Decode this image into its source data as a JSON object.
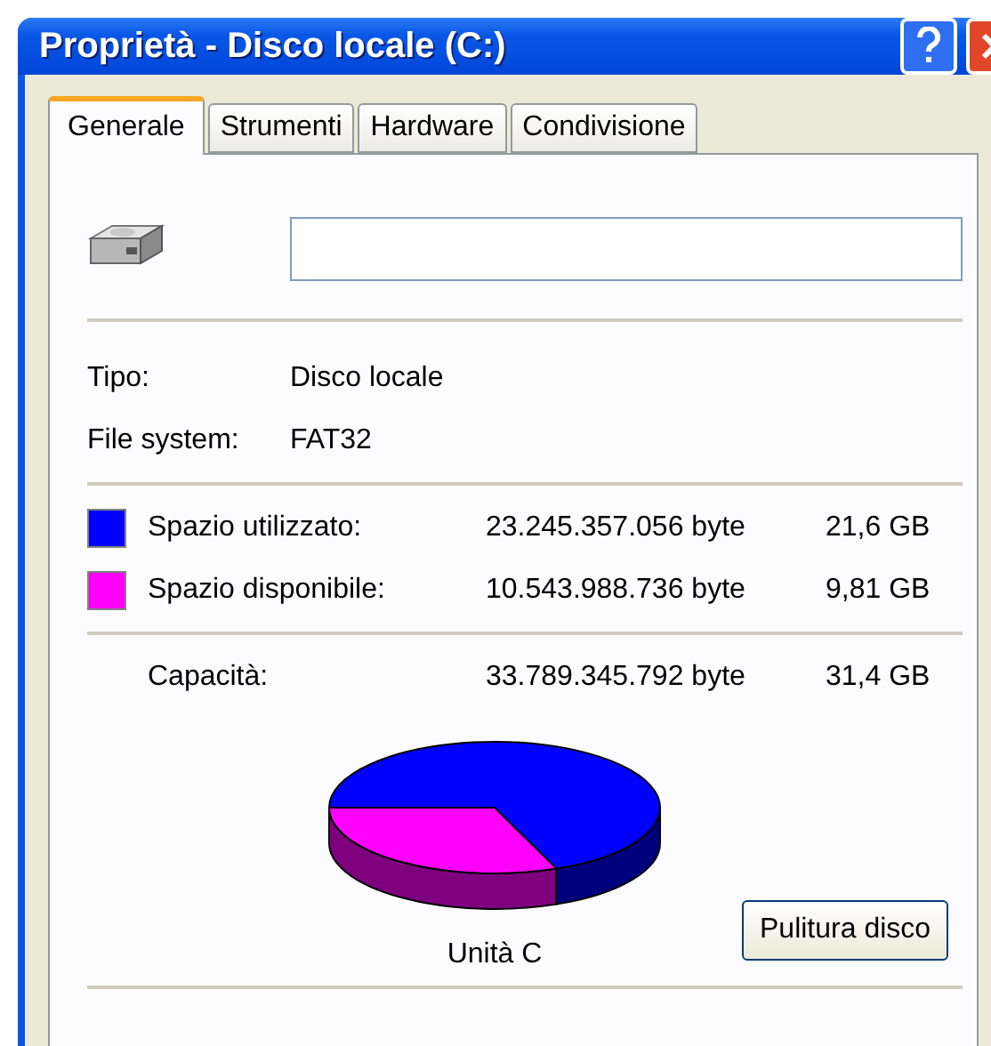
{
  "window": {
    "title": "Proprietà - Disco locale (C:)"
  },
  "tabs": [
    {
      "label": "Generale",
      "selected": true
    },
    {
      "label": "Strumenti",
      "selected": false
    },
    {
      "label": "Hardware",
      "selected": false
    },
    {
      "label": "Condivisione",
      "selected": false
    }
  ],
  "info": [
    {
      "label": "Tipo:",
      "value": "Disco locale"
    },
    {
      "label": "File system:",
      "value": "FAT32"
    }
  ],
  "space": [
    {
      "label": "Spazio utilizzato:",
      "bytes": "23.245.357.056 byte",
      "size": "21,6 GB",
      "color": "#0000ff"
    },
    {
      "label": "Spazio disponibile:",
      "bytes": "10.543.988.736 byte",
      "size": "9,81 GB",
      "color": "#ff00ff"
    }
  ],
  "capacity": {
    "label": "Capacità:",
    "bytes": "33.789.345.792 byte",
    "size": "31,4 GB"
  },
  "drive_label": "Unità C",
  "cleanup_button": "Pulitura disco"
}
